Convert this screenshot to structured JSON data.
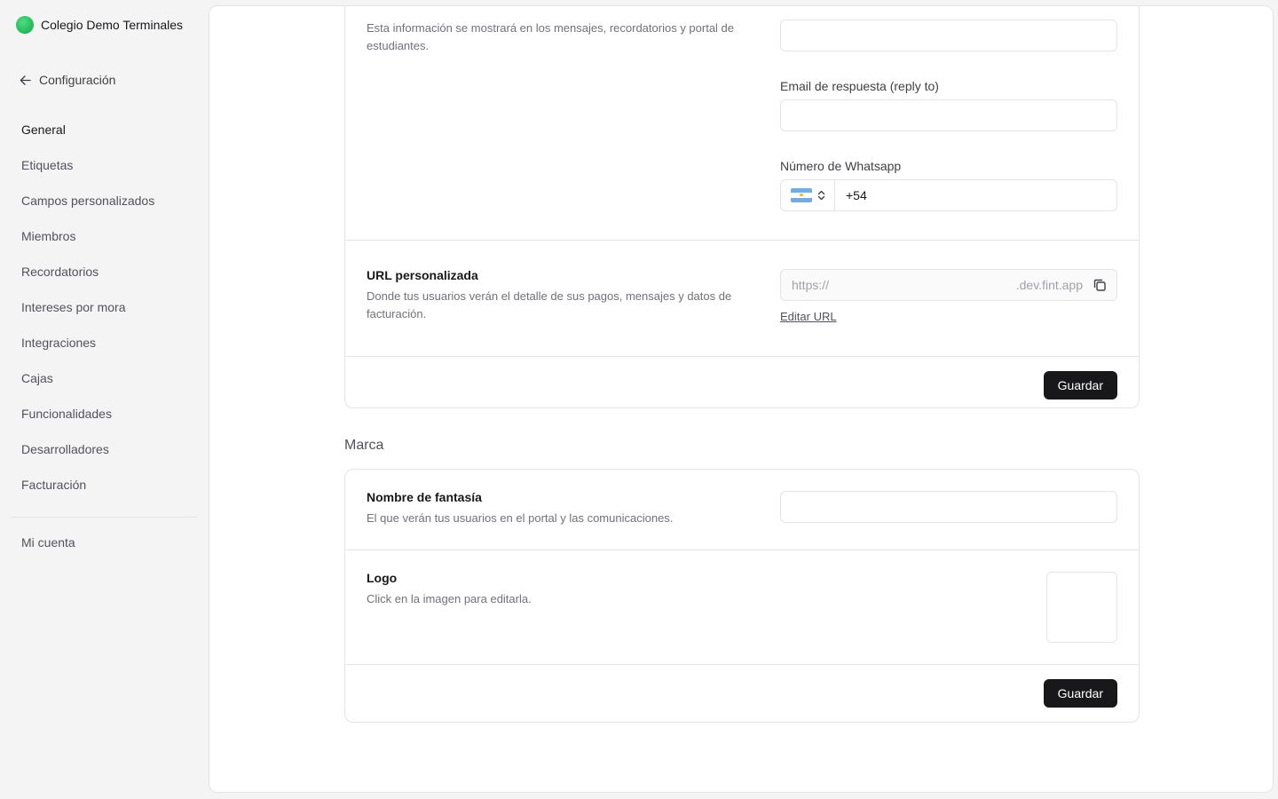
{
  "sidebar": {
    "org_name": "Colegio Demo Terminales",
    "back_label": "Configuración",
    "items": [
      {
        "label": "General",
        "active": true
      },
      {
        "label": "Etiquetas"
      },
      {
        "label": "Campos personalizados"
      },
      {
        "label": "Miembros"
      },
      {
        "label": "Recordatorios"
      },
      {
        "label": "Intereses por mora"
      },
      {
        "label": "Integraciones"
      },
      {
        "label": "Cajas"
      },
      {
        "label": "Funcionalidades"
      },
      {
        "label": "Desarrolladores"
      },
      {
        "label": "Facturación"
      }
    ],
    "account_label": "Mi cuenta"
  },
  "contact": {
    "description": "Esta información se mostrará en los mensajes, recordatorios y portal de estudiantes.",
    "reply_to_label": "Email de respuesta (reply to)",
    "whatsapp_label": "Número de Whatsapp",
    "whatsapp_country": "AR",
    "whatsapp_value": "+54"
  },
  "custom_url": {
    "title": "URL personalizada",
    "description": "Donde tus usuarios verán el detalle de sus pagos, mensajes y datos de facturación.",
    "prefix": "https://",
    "suffix": ".dev.fint.app",
    "edit_label": "Editar URL"
  },
  "save_label": "Guardar",
  "brand": {
    "group_label": "Marca",
    "fantasy_title": "Nombre de fantasía",
    "fantasy_desc": "El que verán tus usuarios en el portal y las comunicaciones.",
    "logo_title": "Logo",
    "logo_desc": "Click en la imagen para editarla."
  },
  "colors": {
    "accent": "#22c55e",
    "button": "#18181b"
  }
}
